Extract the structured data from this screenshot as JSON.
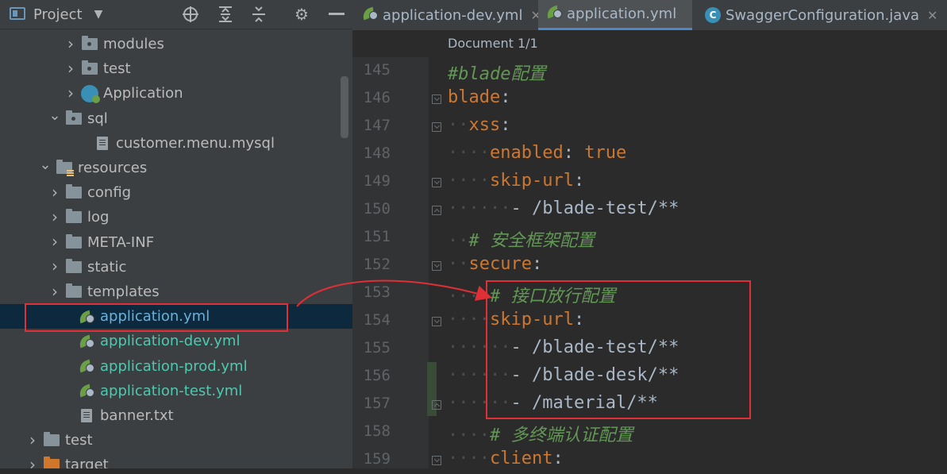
{
  "project_panel": {
    "title": "Project",
    "icons": [
      "project-window-icon",
      "dropdown-icon",
      "locate-icon",
      "expand-all-icon",
      "collapse-all-icon",
      "settings-icon",
      "hide-icon"
    ]
  },
  "tree": [
    {
      "label": "modules",
      "icon": "package-folder-icon",
      "expandable": true,
      "expanded": false,
      "indent": 3
    },
    {
      "label": "test",
      "icon": "package-folder-icon",
      "expandable": true,
      "expanded": false,
      "indent": 3
    },
    {
      "label": "Application",
      "icon": "spring-boot-app-icon",
      "expandable": true,
      "expanded": false,
      "indent": 3
    },
    {
      "label": "sql",
      "icon": "package-folder-icon",
      "expandable": true,
      "expanded": true,
      "indent": 2
    },
    {
      "label": "customer.menu.mysql",
      "icon": "text-file-icon",
      "expandable": false,
      "indent": 3
    },
    {
      "label": "resources",
      "icon": "resources-folder-icon",
      "expandable": true,
      "expanded": true,
      "indent": 1
    },
    {
      "label": "config",
      "icon": "folder-icon",
      "expandable": true,
      "expanded": false,
      "indent": 2
    },
    {
      "label": "log",
      "icon": "folder-icon",
      "expandable": true,
      "expanded": false,
      "indent": 2
    },
    {
      "label": "META-INF",
      "icon": "folder-icon",
      "expandable": true,
      "expanded": false,
      "indent": 2
    },
    {
      "label": "static",
      "icon": "folder-icon",
      "expandable": true,
      "expanded": false,
      "indent": 2
    },
    {
      "label": "templates",
      "icon": "folder-icon",
      "expandable": true,
      "expanded": false,
      "indent": 2
    },
    {
      "label": "application.yml",
      "icon": "spring-yml-icon",
      "expandable": false,
      "indent": 2,
      "selected": true
    },
    {
      "label": "application-dev.yml",
      "icon": "spring-yml-icon",
      "expandable": false,
      "indent": 2
    },
    {
      "label": "application-prod.yml",
      "icon": "spring-yml-icon",
      "expandable": false,
      "indent": 2
    },
    {
      "label": "application-test.yml",
      "icon": "spring-yml-icon",
      "expandable": false,
      "indent": 2
    },
    {
      "label": "banner.txt",
      "icon": "text-file-icon",
      "expandable": false,
      "indent": 2
    },
    {
      "label": "test",
      "icon": "folder-icon",
      "expandable": true,
      "expanded": false,
      "indent": 0
    },
    {
      "label": "target",
      "icon": "excluded-folder-icon",
      "expandable": true,
      "expanded": false,
      "indent": 0
    }
  ],
  "tabs": [
    {
      "label": "application-dev.yml",
      "icon": "spring-yml-icon",
      "active": false
    },
    {
      "label": "application.yml",
      "icon": "spring-yml-icon",
      "active": true
    },
    {
      "label": "SwaggerConfiguration.java",
      "icon": "java-class-icon",
      "active": false
    }
  ],
  "editor": {
    "breadcrumb": "Document 1/1",
    "lines": [
      {
        "no": "145",
        "fold": "",
        "segs": [
          [
            "cm",
            "#blade配置"
          ]
        ]
      },
      {
        "no": "146",
        "fold": "open",
        "segs": [
          [
            "k",
            "blade"
          ],
          [
            "p",
            ":"
          ]
        ]
      },
      {
        "no": "147",
        "fold": "open",
        "segs": [
          [
            "d",
            "··"
          ],
          [
            "k",
            "xss"
          ],
          [
            "p",
            ":"
          ]
        ]
      },
      {
        "no": "148",
        "fold": "",
        "segs": [
          [
            "d",
            "····"
          ],
          [
            "k",
            "enabled"
          ],
          [
            "p",
            ": "
          ],
          [
            "vt",
            "true"
          ]
        ]
      },
      {
        "no": "149",
        "fold": "open",
        "segs": [
          [
            "d",
            "····"
          ],
          [
            "k",
            "skip-url"
          ],
          [
            "p",
            ":"
          ]
        ]
      },
      {
        "no": "150",
        "fold": "close",
        "segs": [
          [
            "d",
            "······"
          ],
          [
            "p",
            "- "
          ],
          [
            "p",
            "/blade-test/**"
          ]
        ]
      },
      {
        "no": "151",
        "fold": "",
        "segs": [
          [
            "d",
            "··"
          ],
          [
            "cm",
            "# 安全框架配置"
          ]
        ]
      },
      {
        "no": "152",
        "fold": "open",
        "segs": [
          [
            "d",
            "··"
          ],
          [
            "k",
            "secure"
          ],
          [
            "p",
            ":"
          ]
        ]
      },
      {
        "no": "153",
        "fold": "",
        "segs": [
          [
            "d",
            "····"
          ],
          [
            "cm",
            "# 接口放行配置"
          ]
        ]
      },
      {
        "no": "154",
        "fold": "open",
        "segs": [
          [
            "d",
            "····"
          ],
          [
            "k",
            "skip-url"
          ],
          [
            "p",
            ":"
          ]
        ]
      },
      {
        "no": "155",
        "fold": "",
        "segs": [
          [
            "d",
            "······"
          ],
          [
            "p",
            "- "
          ],
          [
            "p",
            "/blade-test/**"
          ]
        ]
      },
      {
        "no": "156",
        "fold": "",
        "segs": [
          [
            "d",
            "······"
          ],
          [
            "p",
            "- "
          ],
          [
            "p",
            "/blade-desk/**"
          ]
        ]
      },
      {
        "no": "157",
        "fold": "close",
        "segs": [
          [
            "d",
            "······"
          ],
          [
            "p",
            "- "
          ],
          [
            "p",
            "/material/**"
          ]
        ]
      },
      {
        "no": "158",
        "fold": "",
        "segs": [
          [
            "d",
            "····"
          ],
          [
            "cm",
            "# 多终端认证配置"
          ]
        ]
      },
      {
        "no": "159",
        "fold": "open",
        "segs": [
          [
            "d",
            "····"
          ],
          [
            "k",
            "client"
          ],
          [
            "p",
            ":"
          ]
        ]
      }
    ]
  },
  "colors": {
    "annotation_red": "#e02f36",
    "keyword": "#cc7832",
    "comment": "#629755",
    "spring_label": "#4ec9b0"
  }
}
